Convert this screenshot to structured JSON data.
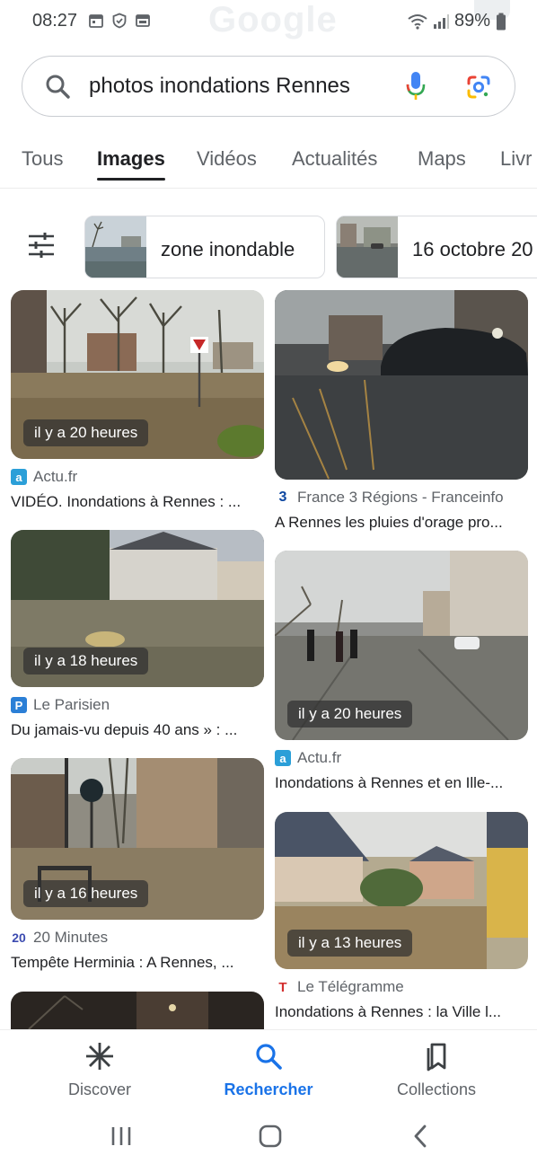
{
  "status_bar": {
    "time": "08:27",
    "battery": "89%",
    "ghost_logo": "Google",
    "icons": [
      "calendar-icon",
      "shield-icon",
      "gallery-icon",
      "wifi-icon",
      "signal-icon",
      "battery-icon"
    ]
  },
  "search": {
    "query": "photos inondations Rennes"
  },
  "tabs": [
    {
      "label": "Tous"
    },
    {
      "label": "Images"
    },
    {
      "label": "Vidéos"
    },
    {
      "label": "Actualités"
    },
    {
      "label": "Maps"
    },
    {
      "label": "Livr"
    }
  ],
  "active_tab": "Images",
  "chips": [
    {
      "label": "zone inondable"
    },
    {
      "label": "16 octobre 20"
    }
  ],
  "results": [
    {
      "time": "il y a 20 heures",
      "source": "Actu.fr",
      "title": "VIDÉO. Inondations à Rennes : ..."
    },
    {
      "time": "",
      "source": "France 3 Régions - Franceinfo",
      "title": "A Rennes les pluies d'orage pro..."
    },
    {
      "time": "il y a 18 heures",
      "source": "Le Parisien",
      "title": "Du jamais-vu depuis 40 ans » : ..."
    },
    {
      "time": "il y a 20 heures",
      "source": "Actu.fr",
      "title": "Inondations à Rennes et en Ille-..."
    },
    {
      "time": "il y a 16 heures",
      "source": "20 Minutes",
      "title": "Tempête Herminia : A Rennes, ..."
    },
    {
      "time": "il y a 13 heures",
      "source": "Le Télégramme",
      "title": "Inondations à Rennes : la Ville l..."
    }
  ],
  "favicons": {
    "actu": "a",
    "france3": "3",
    "parisien": "P",
    "vingt": "20",
    "telegramme": "T"
  },
  "bottom_nav": [
    {
      "label": "Discover",
      "icon": "asterisk-icon"
    },
    {
      "label": "Rechercher",
      "icon": "search-icon"
    },
    {
      "label": "Collections",
      "icon": "bookmarks-icon"
    }
  ],
  "colors": {
    "accent": "#1a73e8",
    "text": "#202124",
    "muted": "#5f6368",
    "actu_fav": "#2b9fd8",
    "parisien_fav": "#2b7fd6",
    "telegramme_fav": "#d32f2f"
  }
}
